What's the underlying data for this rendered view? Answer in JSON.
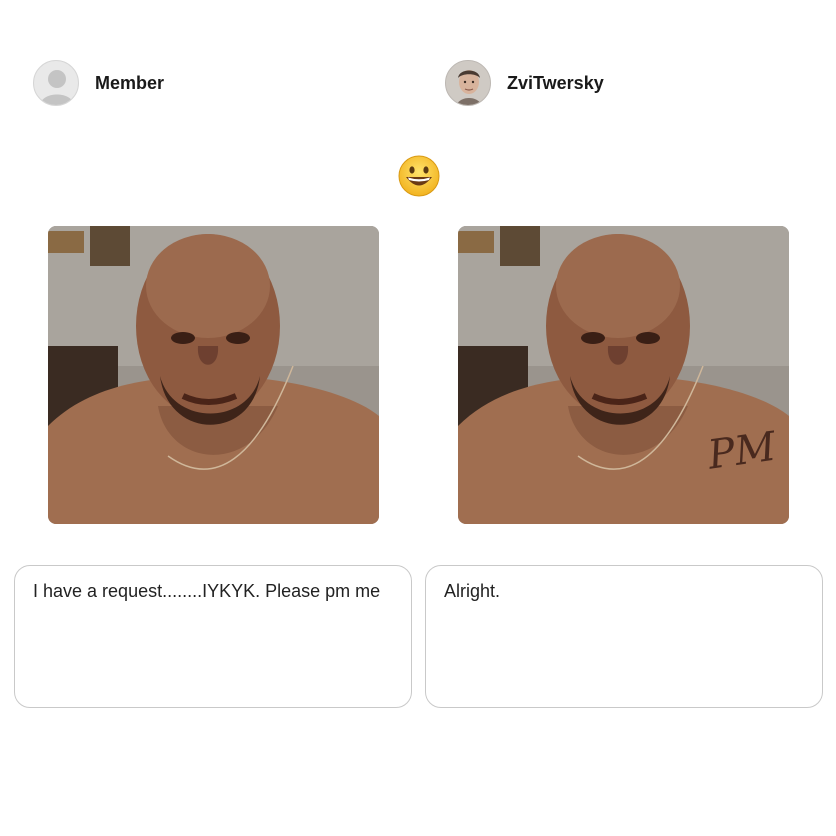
{
  "users": {
    "left": {
      "name": "Member"
    },
    "right": {
      "name": "ZviTwersky"
    }
  },
  "reaction": {
    "icon": "grinning-face-emoji"
  },
  "messages": {
    "left": "I have a request........IYKYK. Please pm me",
    "right": "Alright."
  },
  "images": {
    "left": {
      "subject": "bald-man-photo"
    },
    "right": {
      "subject": "bald-man-photo-with-neck-tattoo",
      "tattoo_text": "PM"
    }
  },
  "colors": {
    "text": "#222222",
    "border": "#c9c9c9",
    "emoji_face": "#f7c531"
  }
}
